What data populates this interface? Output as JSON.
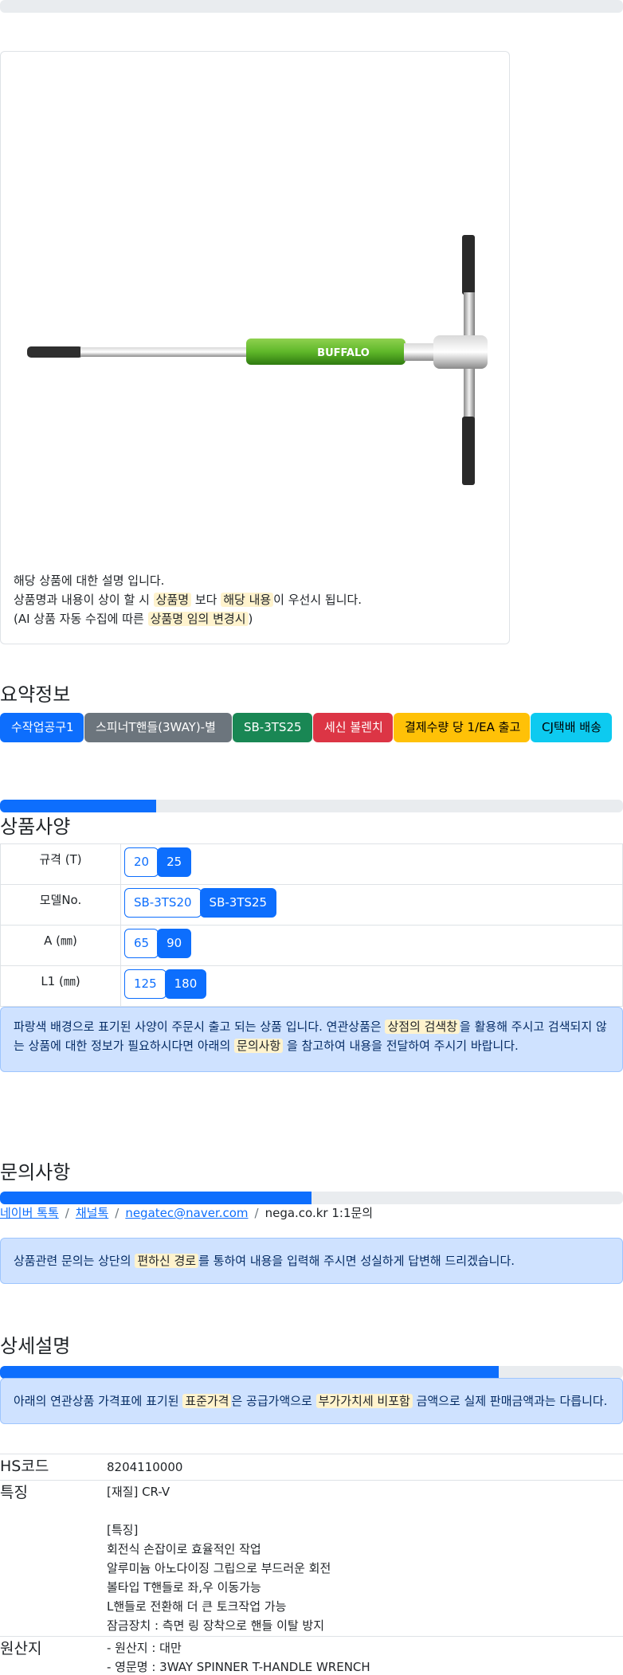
{
  "colors": {
    "primary": "#0d6efd",
    "highlight": "#fff3cd",
    "info_bg": "#cfe2ff"
  },
  "image_notice": {
    "line1": "해당 상품에 대한 설명 입니다.",
    "line2_pre": "상품명과 내용이 상이 할 시 ",
    "line2_mark1": "상품명",
    "line2_mid": " 보다 ",
    "line2_mark2": "해당 내용",
    "line2_post": "이 우선시 됩니다.",
    "line3_pre": "(AI 상품 자동 수집에 따른 ",
    "line3_mark": "상품명 임의 변경시",
    "line3_post": ")",
    "brand_text": "BUFFALO"
  },
  "summary": {
    "title": "요약정보",
    "badges": [
      "수작업공구1",
      "스피너T핸들(3WAY)-별",
      "SB-3TS25",
      "세신 볼렌치",
      "결제수량 당 1/EA 출고",
      "CJ택배 배송"
    ]
  },
  "progress": {
    "p1": 25,
    "p2": 50,
    "p3": 80
  },
  "spec": {
    "title": "상품사양",
    "rows": [
      {
        "label": "규격 (T)",
        "options": [
          "20",
          "25"
        ],
        "active": "25"
      },
      {
        "label": "모델No.",
        "options": [
          "SB-3TS20",
          "SB-3TS25"
        ],
        "active": "SB-3TS25"
      },
      {
        "label": "A (㎜)",
        "options": [
          "65",
          "90"
        ],
        "active": "90"
      },
      {
        "label": "L1 (㎜)",
        "options": [
          "125",
          "180"
        ],
        "active": "180"
      }
    ],
    "notice_pre": "파랑색 배경으로 표기된 사양이 주문시 출고 되는 상품 입니다. 연관상품은 ",
    "notice_mark1": "상점의 검색창",
    "notice_mid": "을 활용해 주시고 검색되지 않는 상품에 대한 정보가 필요하시다면 아래의 ",
    "notice_mark2": "문의사항",
    "notice_post": " 을 참고하여 내용을 전달하여 주시기 바랍니다."
  },
  "inquiry": {
    "title": "문의사항",
    "link1": "네이버 톡톡",
    "link2": "채널톡",
    "link3": "negatec@naver.com",
    "text4": "nega.co.kr 1:1문의",
    "separator": "/",
    "notice_pre": "상품관련 문의는 상단의 ",
    "notice_mark": "편하신 경로",
    "notice_post": "를 통하여 내용을 입력해 주시면 성실하게 답변해 드리겠습니다."
  },
  "detail": {
    "title": "상세설명",
    "notice_pre": "아래의 연관상품 가격표에 표기된 ",
    "notice_mark1": "표준가격",
    "notice_mid": "은 공급가액으로 ",
    "notice_mark2": "부가가치세 비포함",
    "notice_post": " 금액으로 실제 판매금액과는 다릅니다.",
    "hs_label": "HS코드",
    "hs_value": "8204110000",
    "feature_label": "특징",
    "feature_lines": [
      "[재질] CR-V",
      "",
      "[특징]",
      "회전식 손잡이로 효율적인 작업",
      "알루미늄 아노다이징 그립으로 부드러운 회전",
      "볼타입 T핸들로 좌,우 이동가능",
      "L핸들로 전환해 더 큰 토크작업 가능",
      "잠금장치 : 측면 링 장착으로 핸들 이탈 방지"
    ],
    "origin_label": "원산지",
    "origin_lines": [
      "- 원산지 : 대만",
      "- 영문명 : 3WAY SPINNER T-HANDLE WRENCH"
    ]
  }
}
